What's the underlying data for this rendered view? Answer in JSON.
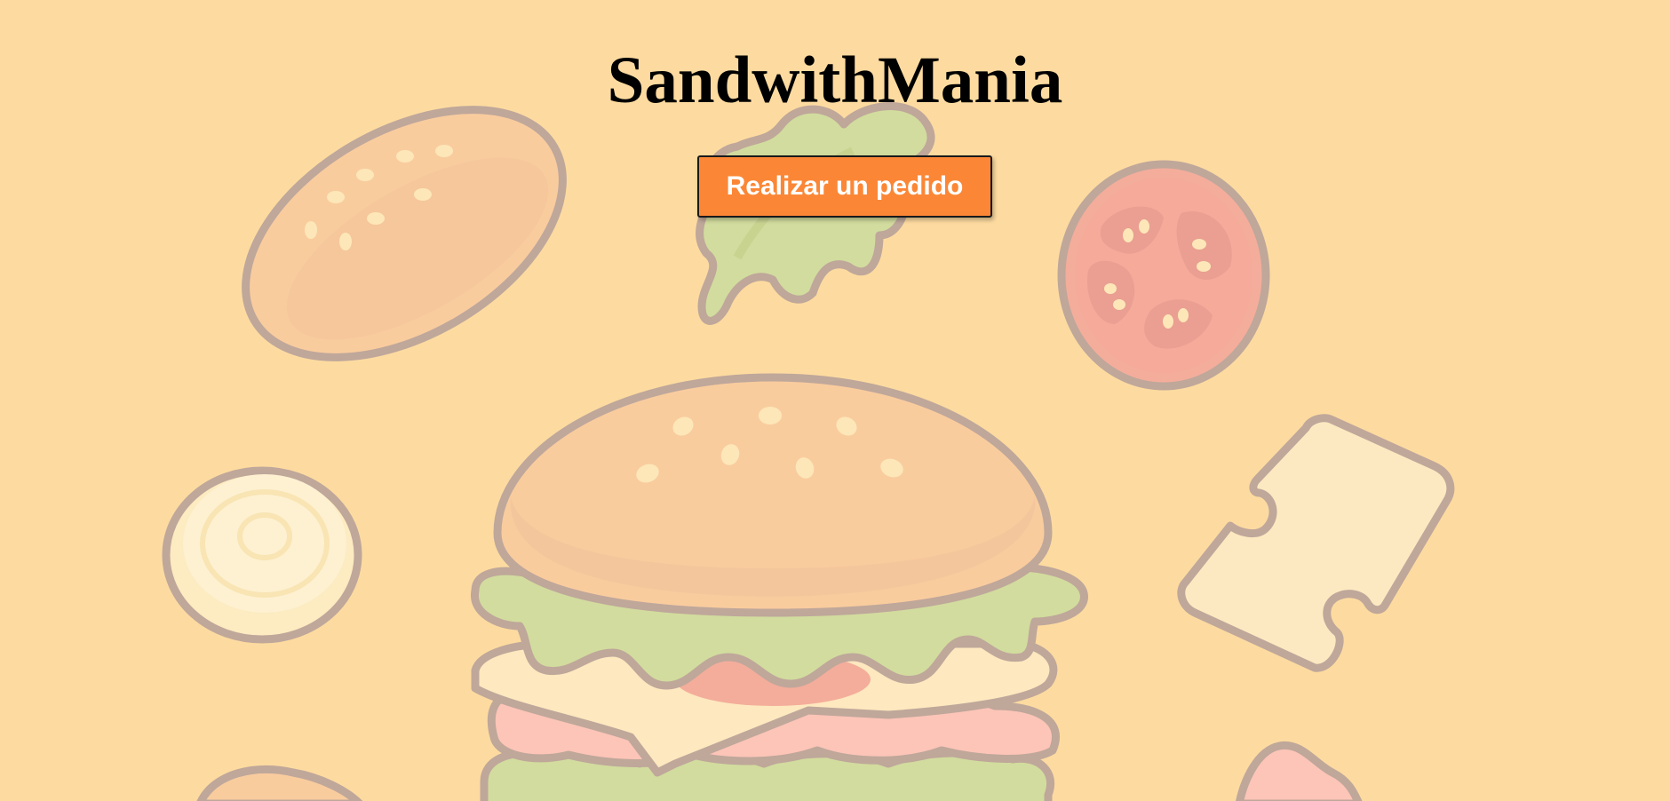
{
  "app": {
    "title": "SandwithMania"
  },
  "actions": {
    "order_button_label": "Realizar un pedido"
  },
  "theme": {
    "background": "#fddba0",
    "button_color": "#fb8736",
    "button_text_color": "#ffffff",
    "title_color": "#000000"
  },
  "decorations": {
    "icons": [
      "bun-icon",
      "lettuce-icon",
      "tomato-slice-icon",
      "onion-slice-icon",
      "cheese-slice-icon",
      "burger-stack-icon",
      "ham-icon"
    ]
  }
}
